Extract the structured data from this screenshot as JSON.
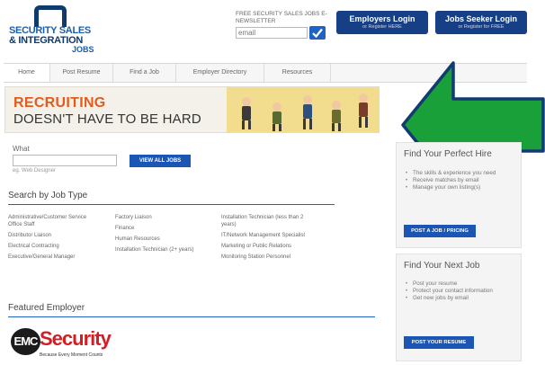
{
  "brand": {
    "logo_line1": "SECURITY SALES",
    "logo_line2": "& INTEGRATION",
    "logo_line3": "JOBS"
  },
  "newsletter": {
    "label": "FREE SECURITY SALES JOBS E-NEWSLETTER",
    "email_value": "email"
  },
  "header_buttons": {
    "employers_title": "Employers Login",
    "employers_sub": "or Register HERE",
    "seekers_title": "Jobs Seeker Login",
    "seekers_sub": "or Register for FREE"
  },
  "nav": [
    "Home",
    "Post Resume",
    "Find a Job",
    "Employer Directory",
    "Resources"
  ],
  "banner": {
    "line1": "RECRUITING",
    "line2": "DOESN'T HAVE TO BE HARD"
  },
  "search": {
    "what_label": "What",
    "hint": "eg. Web Designer",
    "view_all": "VIEW ALL JOBS"
  },
  "job_type": {
    "title": "Search by Job Type",
    "col1": [
      "Administrative/Customer Service Office Staff",
      "Distributor Liaison",
      "Electrical Contracting",
      "Executive/General Manager"
    ],
    "col2": [
      "Factory Liaison",
      "Finance",
      "Human Resources",
      "Installation Technician (2+ years)"
    ],
    "col3": [
      "Installation Technician (less than 2 years)",
      "IT/Network Management Specialist",
      "Marketing or Public Relations",
      "Monitoring Station Personnel"
    ]
  },
  "featured": {
    "title": "Featured Employer",
    "logo_emc": "EMC",
    "logo_security": "Security",
    "logo_tagline": "Because Every Moment Counts"
  },
  "hire_box": {
    "title": "Find Your Perfect Hire",
    "bullets": [
      "The skills & experience you need",
      "Receive matches by email",
      "Manage your own listing(s)"
    ],
    "button": "POST A JOB / PRICING"
  },
  "job_box": {
    "title": "Find Your Next Job",
    "bullets": [
      "Post your resume",
      "Protect your contact information",
      "Get new jobs by email"
    ],
    "button": "POST YOUR RESUME"
  },
  "colors": {
    "arrow_fill": "#1aa038",
    "arrow_stroke": "#123b72",
    "accent_blue": "#1c56b4",
    "banner_orange": "#e65a1a"
  }
}
